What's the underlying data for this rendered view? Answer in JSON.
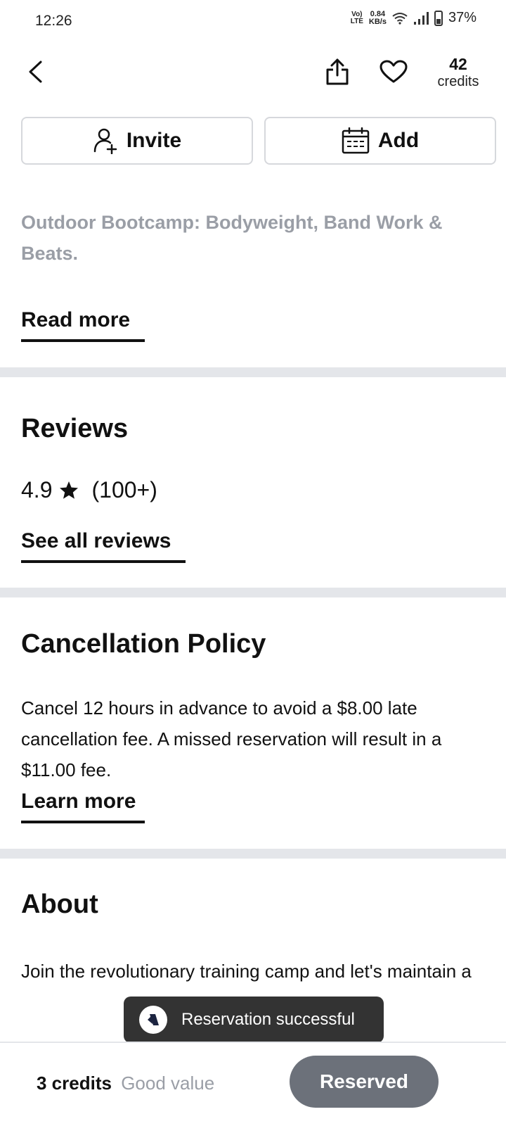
{
  "status_bar": {
    "time": "12:26",
    "network_label_top": "Vo)",
    "network_label_bottom": "LTE",
    "speed_value": "0.84",
    "speed_unit": "KB/s",
    "battery": "37%"
  },
  "header": {
    "credits_count": "42",
    "credits_label": "credits"
  },
  "actions": {
    "invite_label": "Invite",
    "add_label": "Add"
  },
  "description": {
    "text": "Outdoor Bootcamp: Bodyweight, Band Work & Beats.",
    "read_more": "Read more"
  },
  "reviews": {
    "title": "Reviews",
    "rating": "4.9",
    "count": "(100+)",
    "see_all": "See all reviews"
  },
  "cancellation": {
    "title": "Cancellation Policy",
    "text": "Cancel 12 hours in advance to avoid a $8.00 late cancellation fee. A missed reservation will result in a $11.00 fee.",
    "learn_more": "Learn more"
  },
  "about": {
    "title": "About",
    "text": "Join the revolutionary training camp and let's maintain a"
  },
  "toast": {
    "message": "Reservation successful"
  },
  "footer": {
    "price_credits": "3 credits",
    "price_note": "Good value",
    "reserved_label": "Reserved"
  },
  "colors": {
    "muted_text": "#9a9ea6",
    "divider": "#e4e6ea",
    "reserved_button": "#6c717a",
    "toast_bg": "#333333"
  }
}
